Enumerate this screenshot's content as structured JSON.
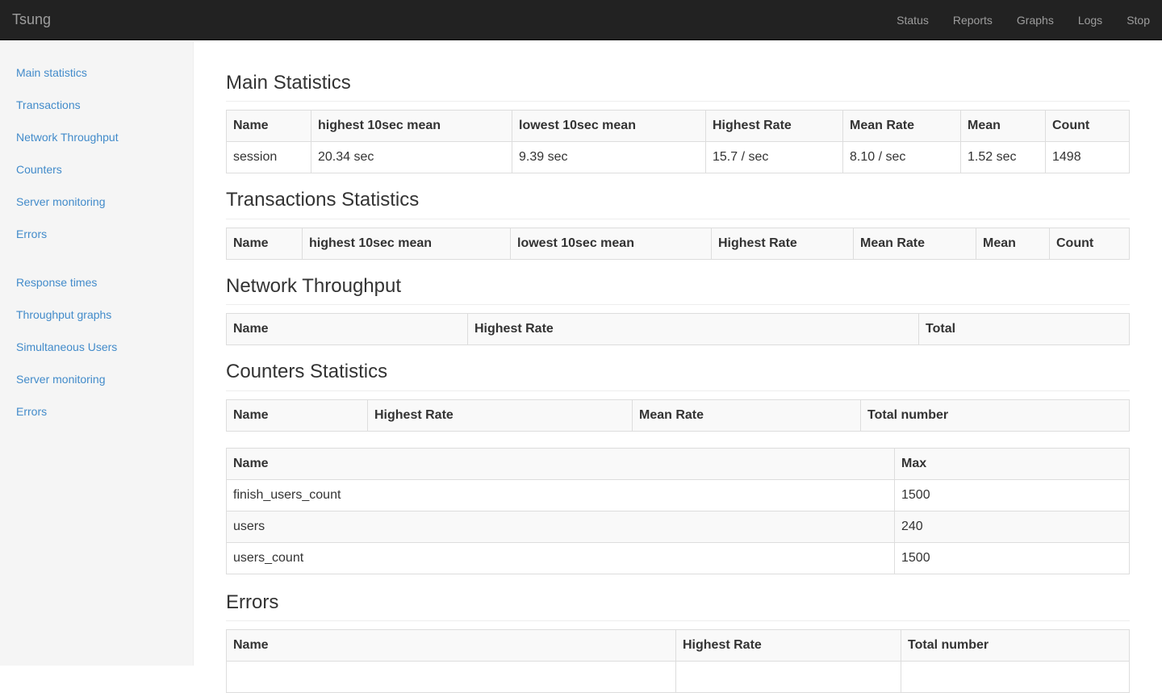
{
  "navbar": {
    "brand": "Tsung",
    "links": [
      "Status",
      "Reports",
      "Graphs",
      "Logs",
      "Stop"
    ]
  },
  "sidebar": {
    "reports": [
      "Main statistics",
      "Transactions",
      "Network Throughput",
      "Counters",
      "Server monitoring",
      "Errors"
    ],
    "graphs": [
      "Response times",
      "Throughput graphs",
      "Simultaneous Users",
      "Server monitoring",
      "Errors"
    ]
  },
  "main_stats": {
    "title": "Main Statistics",
    "headers": [
      "Name",
      "highest 10sec mean",
      "lowest 10sec mean",
      "Highest Rate",
      "Mean Rate",
      "Mean",
      "Count"
    ],
    "row": [
      "session",
      "20.34 sec",
      "9.39 sec",
      "15.7 / sec",
      "8.10 / sec",
      "1.52 sec",
      "1498"
    ]
  },
  "transactions": {
    "title": "Transactions Statistics",
    "headers": [
      "Name",
      "highest 10sec mean",
      "lowest 10sec mean",
      "Highest Rate",
      "Mean Rate",
      "Mean",
      "Count"
    ]
  },
  "network": {
    "title": "Network Throughput",
    "headers": [
      "Name",
      "Highest Rate",
      "Total"
    ]
  },
  "counters": {
    "title": "Counters Statistics",
    "headers": [
      "Name",
      "Highest Rate",
      "Mean Rate",
      "Total number"
    ],
    "max_headers": [
      "Name",
      "Max"
    ],
    "max_rows": [
      [
        "finish_users_count",
        "1500"
      ],
      [
        "users",
        "240"
      ],
      [
        "users_count",
        "1500"
      ]
    ]
  },
  "errors": {
    "title": "Errors",
    "headers": [
      "Name",
      "Highest Rate",
      "Total number"
    ]
  },
  "colors": {
    "navbar_bg": "#222222",
    "link": "#428bca",
    "sidebar_bg": "#f5f5f5"
  }
}
